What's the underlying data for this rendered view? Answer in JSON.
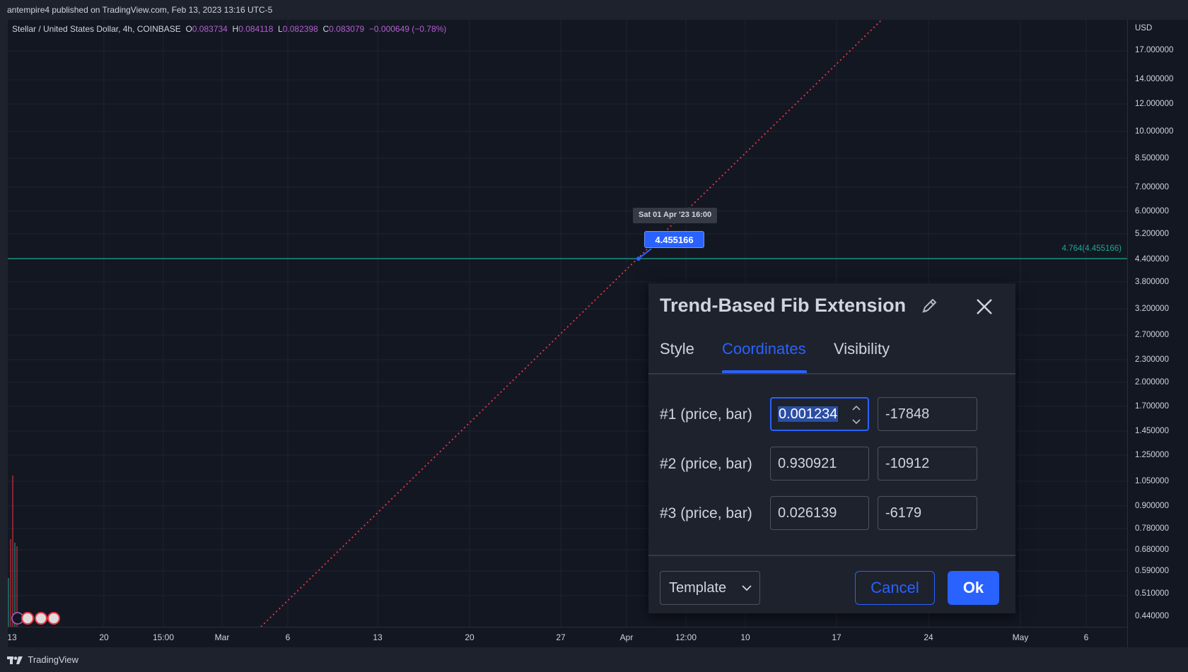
{
  "header": {
    "published": "antempire4 published on TradingView.com, Feb 13, 2023 13:16 UTC-5"
  },
  "legend": {
    "symbol": "Stellar / United States Dollar, 4h, COINBASE",
    "o_label": "O",
    "o_value": "0.083734",
    "h_label": "H",
    "h_value": "0.084118",
    "l_label": "L",
    "l_value": "0.082398",
    "c_label": "C",
    "c_value": "0.083079",
    "change": "−0.000649 (−0.78%)"
  },
  "price_axis": {
    "currency": "USD",
    "ticks": [
      "17.000000",
      "14.000000",
      "12.000000",
      "10.000000",
      "8.500000",
      "7.000000",
      "6.000000",
      "5.200000",
      "4.400000",
      "3.800000",
      "3.200000",
      "2.700000",
      "2.300000",
      "2.000000",
      "1.700000",
      "1.450000",
      "1.250000",
      "1.050000",
      "0.900000",
      "0.780000",
      "0.680000",
      "0.590000",
      "0.510000",
      "0.440000"
    ]
  },
  "time_axis": {
    "ticks": [
      "13",
      "20",
      "15:00",
      "Mar",
      "6",
      "13",
      "20",
      "27",
      "Apr",
      "12:00",
      "10",
      "17",
      "24",
      "May",
      "6"
    ]
  },
  "chart": {
    "fib_level_label": "4.764(4.455166)",
    "tooltip_time": "Sat 01 Apr '23   16:00",
    "tooltip_price": "4.455166",
    "line_color": "#f23645",
    "fib_color": "#1ea896"
  },
  "dialog": {
    "title": "Trend-Based Fib Extension",
    "tabs": [
      "Style",
      "Coordinates",
      "Visibility"
    ],
    "active_tab": "Coordinates",
    "rows": [
      {
        "label": "#1 (price, bar)",
        "price": "0.001234",
        "bar": "-17848"
      },
      {
        "label": "#2 (price, bar)",
        "price": "0.930921",
        "bar": "-10912"
      },
      {
        "label": "#3 (price, bar)",
        "price": "0.026139",
        "bar": "-6179"
      }
    ],
    "template_label": "Template",
    "cancel_label": "Cancel",
    "ok_label": "Ok"
  },
  "footer": {
    "brand": "TradingView"
  },
  "colors": {
    "accent": "#2962ff",
    "background": "#131722",
    "panel": "#1e222d"
  }
}
